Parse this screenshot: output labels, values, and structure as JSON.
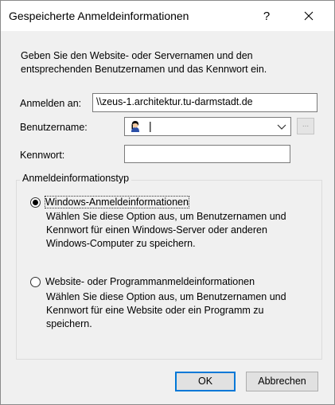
{
  "window": {
    "title": "Gespeicherte Anmeldeinformationen",
    "help_label": "?"
  },
  "instructions": "Geben Sie den Website- oder Servernamen und den entsprechenden Benutzernamen und das Kennwort ein.",
  "fields": {
    "login_label": "Anmelden an:",
    "login_value": "\\\\zeus-1.architektur.tu-darmstadt.de",
    "username_label": "Benutzername:",
    "username_value": "|",
    "password_label": "Kennwort:",
    "password_value": "",
    "browse_label": "..."
  },
  "group": {
    "title": "Anmeldeinformationstyp",
    "options": [
      {
        "label": "Windows-Anmeldeinformationen",
        "description": "Wählen Sie diese Option aus, um Benutzernamen und Kennwort für einen Windows-Server oder anderen Windows-Computer zu speichern.",
        "selected": true
      },
      {
        "label": "Website- oder Programmanmeldeinformationen",
        "description": "Wählen Sie diese Option aus, um Benutzernamen und Kennwort für eine Website oder ein Programm zu speichern.",
        "selected": false
      }
    ]
  },
  "buttons": {
    "ok": "OK",
    "cancel": "Abbrechen"
  },
  "icons": {
    "close": "close-icon",
    "user": "user-avatar-icon",
    "dropdown": "chevron-down-icon"
  },
  "colors": {
    "accent": "#0078d7",
    "dialog_bg": "#f0f0f0"
  }
}
